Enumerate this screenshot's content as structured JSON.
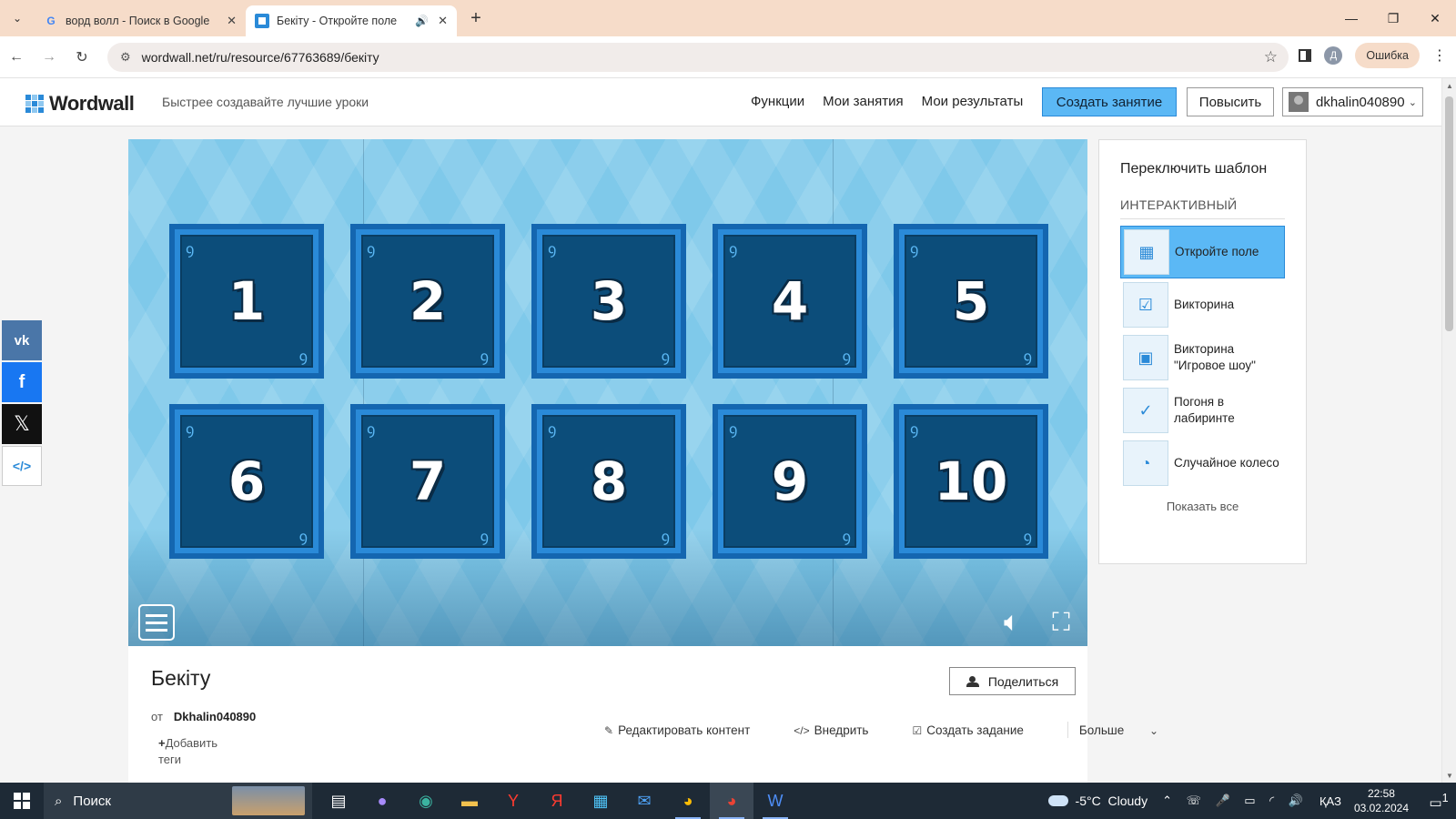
{
  "browser": {
    "tabs": [
      {
        "title": "ворд волл - Поиск в Google",
        "favicon": "google-favicon",
        "active": false
      },
      {
        "title": "Бекіту - Откройте поле",
        "favicon": "wordwall-favicon",
        "active": true
      }
    ],
    "url": "wordwall.net/ru/resource/67763689/бекіту",
    "profile_initial": "Д",
    "error_label": "Ошибка"
  },
  "header": {
    "logo": "Wordwall",
    "tagline": "Быстрее создавайте лучшие уроки",
    "nav": [
      "Функции",
      "Мои занятия",
      "Мои результаты"
    ],
    "create_button": "Создать занятие",
    "upgrade_button": "Повысить",
    "username": "dkhalin040890"
  },
  "social": {
    "vk": "vk",
    "facebook": "f",
    "x": "𝕏",
    "embed": "</>"
  },
  "game": {
    "boxes": [
      "1",
      "2",
      "3",
      "4",
      "5",
      "6",
      "7",
      "8",
      "9",
      "10"
    ]
  },
  "template_panel": {
    "title": "Переключить шаблон",
    "section": "ИНТЕРАКТИВНЫЙ",
    "items": [
      {
        "label": "Откройте поле",
        "icon": "open-box-icon",
        "active": true
      },
      {
        "label": "Викторина",
        "icon": "quiz-icon",
        "active": false
      },
      {
        "label": "Викторина \"Игровое шоу\"",
        "icon": "gameshow-quiz-icon",
        "active": false
      },
      {
        "label": "Погоня в лабиринте",
        "icon": "maze-chase-icon",
        "active": false
      },
      {
        "label": "Случайное колесо",
        "icon": "random-wheel-icon",
        "active": false
      }
    ],
    "show_all": "Показать все"
  },
  "activity": {
    "title": "Бекіту",
    "by_label": "от",
    "author": "Dkhalin040890",
    "add_tags": "Добавить теги",
    "share_button": "Поделиться",
    "actions": {
      "edit": "Редактировать контент",
      "embed": "Внедрить",
      "assign": "Создать задание",
      "more": "Больше"
    }
  },
  "taskbar": {
    "search": "Поиск",
    "temperature": "-5°C",
    "weather": "Cloudy",
    "lang": "ҚАЗ",
    "time": "22:58",
    "date": "03.02.2024",
    "notif_count": "1"
  }
}
